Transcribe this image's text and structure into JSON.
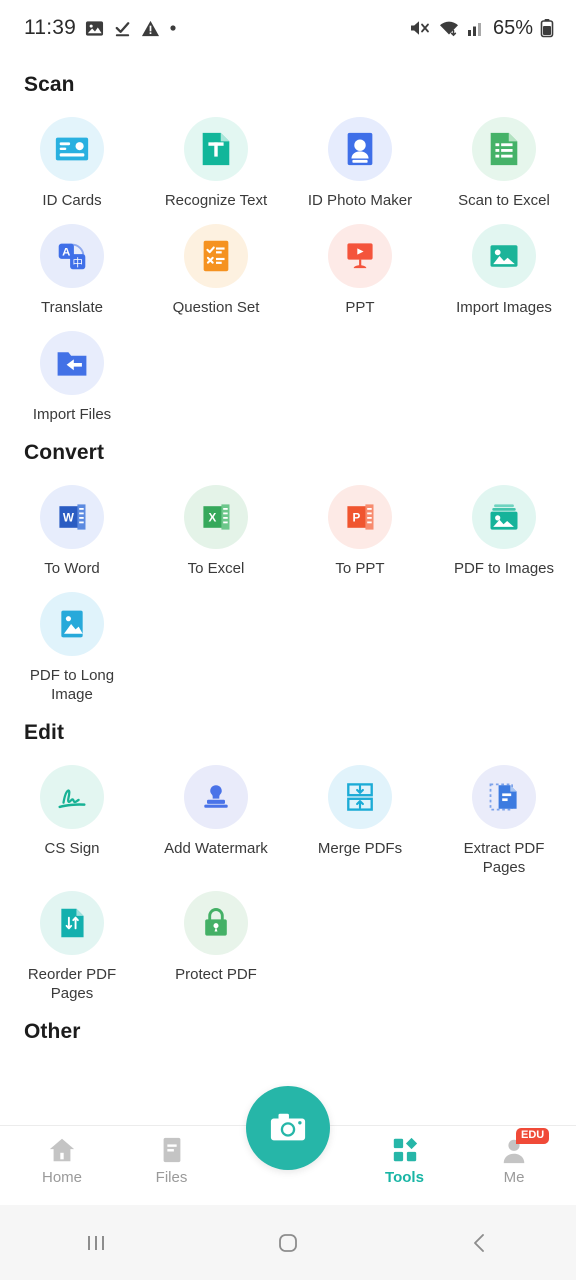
{
  "status_bar": {
    "time": "11:39",
    "battery_percent": "65%",
    "icons": [
      "image-icon",
      "download-check-icon",
      "warning-triangle-icon",
      "dot-icon",
      "mute-icon",
      "wifi-icon",
      "signal-icon",
      "battery-icon"
    ]
  },
  "sections": [
    {
      "title": "Scan",
      "items": [
        {
          "label": "ID Cards",
          "icon": "id-card-icon",
          "bubble": "#e3f4fb",
          "color": "#29b0e0"
        },
        {
          "label": "Recognize Text",
          "icon": "recognize-text-icon",
          "bubble": "#e3f7f2",
          "color": "#12b69a"
        },
        {
          "label": "ID Photo Maker",
          "icon": "id-photo-icon",
          "bubble": "#e6ecfd",
          "color": "#3f6fe8"
        },
        {
          "label": "Scan to Excel",
          "icon": "scan-excel-icon",
          "bubble": "#e6f6ec",
          "color": "#45b268"
        },
        {
          "label": "Translate",
          "icon": "translate-icon",
          "bubble": "#e7ecfb",
          "color": "#3f6fe8"
        },
        {
          "label": "Question Set",
          "icon": "question-set-icon",
          "bubble": "#fdf1e0",
          "color": "#f59220"
        },
        {
          "label": "PPT",
          "icon": "ppt-icon",
          "bubble": "#fdeae7",
          "color": "#f4543c"
        },
        {
          "label": "Import Images",
          "icon": "import-images-icon",
          "bubble": "#e2f6f1",
          "color": "#1bb499"
        },
        {
          "label": "Import Files",
          "icon": "import-files-icon",
          "bubble": "#e8edfc",
          "color": "#4271e6"
        }
      ]
    },
    {
      "title": "Convert",
      "items": [
        {
          "label": "To Word",
          "icon": "word-icon",
          "bubble": "#e7edfc",
          "color": "#2a5cc2"
        },
        {
          "label": "To Excel",
          "icon": "excel-icon",
          "bubble": "#e4f3e8",
          "color": "#36a85b"
        },
        {
          "label": "To PPT",
          "icon": "powerpoint-icon",
          "bubble": "#fdeae6",
          "color": "#f0552f"
        },
        {
          "label": "PDF to Images",
          "icon": "pdf-to-images-icon",
          "bubble": "#e1f6f1",
          "color": "#15b39a"
        },
        {
          "label": "PDF to Long Image",
          "icon": "long-image-icon",
          "bubble": "#e0f3fb",
          "color": "#27a9da"
        }
      ]
    },
    {
      "title": "Edit",
      "items": [
        {
          "label": "CS Sign",
          "icon": "signature-icon",
          "bubble": "#e3f6f1",
          "color": "#17b295"
        },
        {
          "label": "Add Watermark",
          "icon": "watermark-icon",
          "bubble": "#e9ebfa",
          "color": "#4a73e8"
        },
        {
          "label": "Merge PDFs",
          "icon": "merge-pdf-icon",
          "bubble": "#e1f3fb",
          "color": "#1cabd6"
        },
        {
          "label": "Extract PDF Pages",
          "icon": "extract-pdf-icon",
          "bubble": "#eaecfa",
          "color": "#3d7be0"
        },
        {
          "label": "Reorder PDF Pages",
          "icon": "reorder-pdf-icon",
          "bubble": "#e2f5f2",
          "color": "#13b0ae"
        },
        {
          "label": "Protect PDF",
          "icon": "protect-pdf-icon",
          "bubble": "#e8f4ea",
          "color": "#44b066"
        }
      ]
    },
    {
      "title": "Other",
      "items": []
    }
  ],
  "bottom_nav": {
    "items": [
      {
        "label": "Home",
        "icon": "home-icon",
        "active": false
      },
      {
        "label": "Files",
        "icon": "files-icon",
        "active": false
      },
      {
        "label": "Tools",
        "icon": "tools-icon",
        "active": true
      },
      {
        "label": "Me",
        "icon": "avatar-icon",
        "active": false,
        "badge": "EDU"
      }
    ],
    "camera_button": "camera-icon",
    "accent_color": "#26b6a8"
  },
  "system_nav": {
    "recents": "recents-icon",
    "home": "home-square-icon",
    "back": "back-chevron-icon"
  }
}
